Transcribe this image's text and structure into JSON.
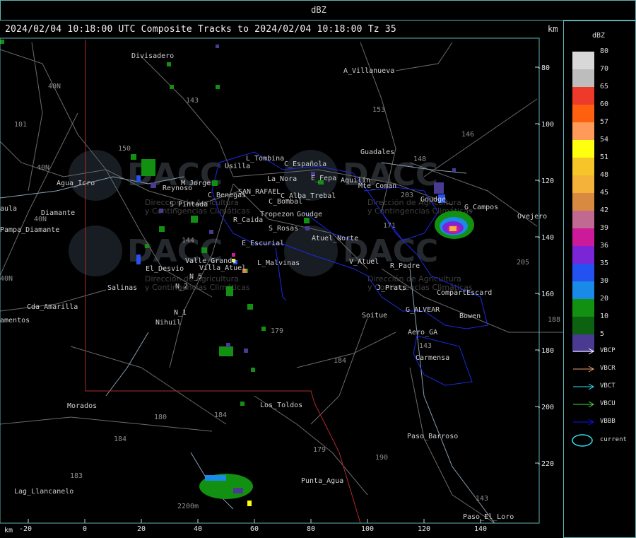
{
  "window": {
    "title": "dBZ"
  },
  "header": {
    "text": "2024/02/04 10:18:00 UTC Composite Tracks to 2024/02/04 10:18:00 Tz 35",
    "km_top": "km",
    "km_bottom": "km"
  },
  "legend": {
    "title": "dBZ",
    "levels": [
      {
        "label": "80",
        "color": "#d8d8d8"
      },
      {
        "label": "70",
        "color": "#bdbdbd"
      },
      {
        "label": "65",
        "color": "#ee3a2a"
      },
      {
        "label": "60",
        "color": "#ff6010"
      },
      {
        "label": "57",
        "color": "#ff9a5a"
      },
      {
        "label": "54",
        "color": "#ffff10"
      },
      {
        "label": "51",
        "color": "#f6c52a"
      },
      {
        "label": "48",
        "color": "#f4b23a"
      },
      {
        "label": "45",
        "color": "#d88a40"
      },
      {
        "label": "42",
        "color": "#c06a92"
      },
      {
        "label": "39",
        "color": "#cc1a9a"
      },
      {
        "label": "36",
        "color": "#7a26d6"
      },
      {
        "label": "35",
        "color": "#2452f0"
      },
      {
        "label": "30",
        "color": "#1a8ae8"
      },
      {
        "label": "20",
        "color": "#129012"
      },
      {
        "label": "10",
        "color": "#0c6210"
      },
      {
        "label": "5",
        "color": "#4a3a92"
      }
    ],
    "tracks": [
      {
        "label": "VBCP",
        "color": "#ffffff"
      },
      {
        "label": "VBCR",
        "color": "#f0a070"
      },
      {
        "label": "VBCT",
        "color": "#30e0f0"
      },
      {
        "label": "VBCU",
        "color": "#40e040"
      },
      {
        "label": "VBBB",
        "color": "#1010ff"
      }
    ],
    "current_label": "current",
    "current_color": "#30e0f0"
  },
  "axes": {
    "x_ticks": [
      "-20",
      "0",
      "20",
      "40",
      "60",
      "80",
      "100",
      "120",
      "140"
    ],
    "y_ticks": [
      "-80",
      "-100",
      "-120",
      "-140",
      "-160",
      "-180",
      "-200",
      "-220"
    ]
  },
  "places": [
    {
      "name": "Divisadero"
    },
    {
      "name": "A_Villanueva"
    },
    {
      "name": "Guadales"
    },
    {
      "name": "L_Tombina"
    },
    {
      "name": "C_Española"
    },
    {
      "name": "Usilla"
    },
    {
      "name": "La_Nora"
    },
    {
      "name": "E_Fepa"
    },
    {
      "name": "Aquilin"
    },
    {
      "name": "Mte_Coman"
    },
    {
      "name": "Goudge"
    },
    {
      "name": "G_Campos"
    },
    {
      "name": "Ovejero"
    },
    {
      "name": "Agua_Icro"
    },
    {
      "name": "Reynoso"
    },
    {
      "name": "C_Benegas"
    },
    {
      "name": "SAN_RAFAEL"
    },
    {
      "name": "C_Alba_Trebal"
    },
    {
      "name": "S_Pintada"
    },
    {
      "name": "C_Bombal"
    },
    {
      "name": "Tropezon"
    },
    {
      "name": "Goudge"
    },
    {
      "name": "R_Caida"
    },
    {
      "name": "S_Rosas"
    },
    {
      "name": "Pampa_Diamante"
    },
    {
      "name": "Atuel_Norte"
    },
    {
      "name": "E_Escurial"
    },
    {
      "name": "El_Desvio"
    },
    {
      "name": "Valle_Grande"
    },
    {
      "name": "L_Malvinas"
    },
    {
      "name": "V_Atuel"
    },
    {
      "name": "R_Padre"
    },
    {
      "name": "Salinas"
    },
    {
      "name": "N_2"
    },
    {
      "name": "N_5"
    },
    {
      "name": "J_Prats"
    },
    {
      "name": "CompartEscard"
    },
    {
      "name": "Cda_Amarilla"
    },
    {
      "name": "N_1"
    },
    {
      "name": "G_ALVEAR"
    },
    {
      "name": "Soitue"
    },
    {
      "name": "Bowen"
    },
    {
      "name": "Nihuil"
    },
    {
      "name": "Aero_GA"
    },
    {
      "name": "Carmensa"
    },
    {
      "name": "Morados"
    },
    {
      "name": "Los_Toldos"
    },
    {
      "name": "Paso_Barroso"
    },
    {
      "name": "Punta_Agua"
    },
    {
      "name": "Lag_Llancanelo"
    },
    {
      "name": "Paso_El_Loro"
    },
    {
      "name": "Diamante"
    },
    {
      "name": "amentos"
    },
    {
      "name": "aula"
    },
    {
      "name": "Villa_Atuel"
    },
    {
      "name": "M_Jorge"
    }
  ],
  "route_numbers": [
    "143",
    "153",
    "146",
    "148",
    "150",
    "101",
    "40N",
    "40N",
    "40N",
    "144",
    "171",
    "203",
    "179",
    "184",
    "180",
    "184",
    "184",
    "183",
    "190",
    "143",
    "143",
    "179",
    "205",
    "188",
    "40N",
    "2200m"
  ],
  "watermark": {
    "text": "DACC",
    "sub1": "Dirección de Agricultura",
    "sub2": "y Contingencias Climáticas"
  }
}
